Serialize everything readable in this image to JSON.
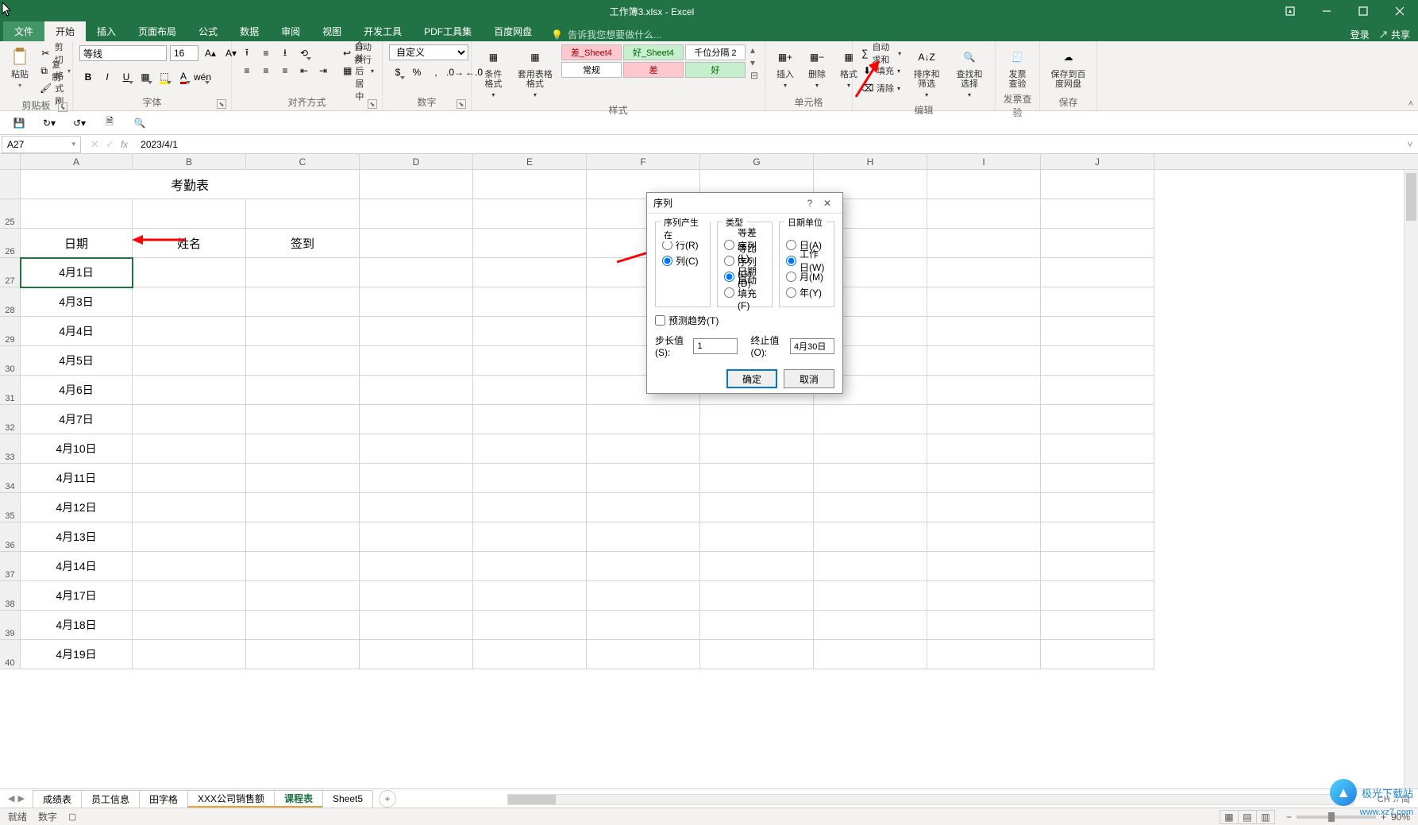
{
  "title": "工作簿3.xlsx - Excel",
  "tabs": {
    "file": "文件",
    "home": "开始",
    "insert": "插入",
    "layout": "页面布局",
    "formula": "公式",
    "data": "数据",
    "review": "审阅",
    "view": "视图",
    "dev": "开发工具",
    "pdf": "PDF工具集",
    "baidu": "百度网盘"
  },
  "tellme": "告诉我您想要做什么...",
  "account": {
    "login": "登录",
    "share": "共享"
  },
  "ribbon": {
    "clipboard": {
      "paste": "粘贴",
      "cut": "剪切",
      "copy": "复制",
      "painter": "格式刷",
      "label": "剪贴板"
    },
    "font": {
      "name": "等线",
      "size": "16",
      "label": "字体"
    },
    "align": {
      "wrap": "自动换行",
      "merge": "合并后居中",
      "label": "对齐方式"
    },
    "number": {
      "format": "自定义",
      "label": "数字"
    },
    "styles": {
      "cond": "条件格式",
      "table": "套用表格格式",
      "bad": "差_Sheet4",
      "good": "好_Sheet4",
      "thousand": "千位分隔 2",
      "normal": "常规",
      "bad2": "差",
      "good2": "好",
      "label": "样式"
    },
    "cells": {
      "insert": "插入",
      "delete": "删除",
      "format": "格式",
      "label": "单元格"
    },
    "edit": {
      "sum": "自动求和",
      "fill": "填充",
      "clear": "清除",
      "sort": "排序和筛选",
      "find": "查找和选择",
      "label": "编辑"
    },
    "invoice": {
      "btn": "发票查验",
      "label": "发票查验"
    },
    "save": {
      "btn": "保存到百度网盘",
      "label": "保存"
    }
  },
  "namebox": "A27",
  "formula": "2023/4/1",
  "columns": [
    "A",
    "B",
    "C",
    "D",
    "E",
    "F",
    "G",
    "H",
    "I",
    "J"
  ],
  "rows": [
    {
      "n": "",
      "h": true,
      "title": "考勤表"
    },
    {
      "n": "25",
      "a": "",
      "b": "",
      "c": ""
    },
    {
      "n": "26",
      "a": "日期",
      "b": "姓名",
      "c": "签到",
      "hdr": true
    },
    {
      "n": "27",
      "a": "4月1日",
      "sel": true
    },
    {
      "n": "28",
      "a": "4月3日"
    },
    {
      "n": "29",
      "a": "4月4日"
    },
    {
      "n": "30",
      "a": "4月5日"
    },
    {
      "n": "31",
      "a": "4月6日"
    },
    {
      "n": "32",
      "a": "4月7日"
    },
    {
      "n": "33",
      "a": "4月10日"
    },
    {
      "n": "34",
      "a": "4月11日"
    },
    {
      "n": "35",
      "a": "4月12日"
    },
    {
      "n": "36",
      "a": "4月13日"
    },
    {
      "n": "37",
      "a": "4月14日"
    },
    {
      "n": "38",
      "a": "4月17日"
    },
    {
      "n": "39",
      "a": "4月18日"
    },
    {
      "n": "40",
      "a": "4月19日"
    }
  ],
  "sheets": [
    "成绩表",
    "员工信息",
    "田字格",
    "XXX公司销售额",
    "课程表",
    "Sheet5"
  ],
  "activeSheet": 4,
  "lang": "CH ♫ 简",
  "status": {
    "ready": "就绪",
    "num": "数字"
  },
  "zoom": "90%",
  "dialog": {
    "title": "序列",
    "seriesIn": {
      "label": "序列产生在",
      "row": "行(R)",
      "col": "列(C)"
    },
    "type": {
      "label": "类型",
      "linear": "等差序列(L)",
      "growth": "等比序列(G)",
      "date": "日期(D)",
      "auto": "自动填充(F)"
    },
    "dateUnit": {
      "label": "日期单位",
      "day": "日(A)",
      "weekday": "工作日(W)",
      "month": "月(M)",
      "year": "年(Y)"
    },
    "trend": "预测趋势(T)",
    "step": {
      "label": "步长值(S):",
      "value": "1"
    },
    "stop": {
      "label": "终止值(O):",
      "value": "4月30日"
    },
    "ok": "确定",
    "cancel": "取消"
  },
  "watermark": {
    "name": "极光下载站",
    "url": "www.xz7.com"
  }
}
